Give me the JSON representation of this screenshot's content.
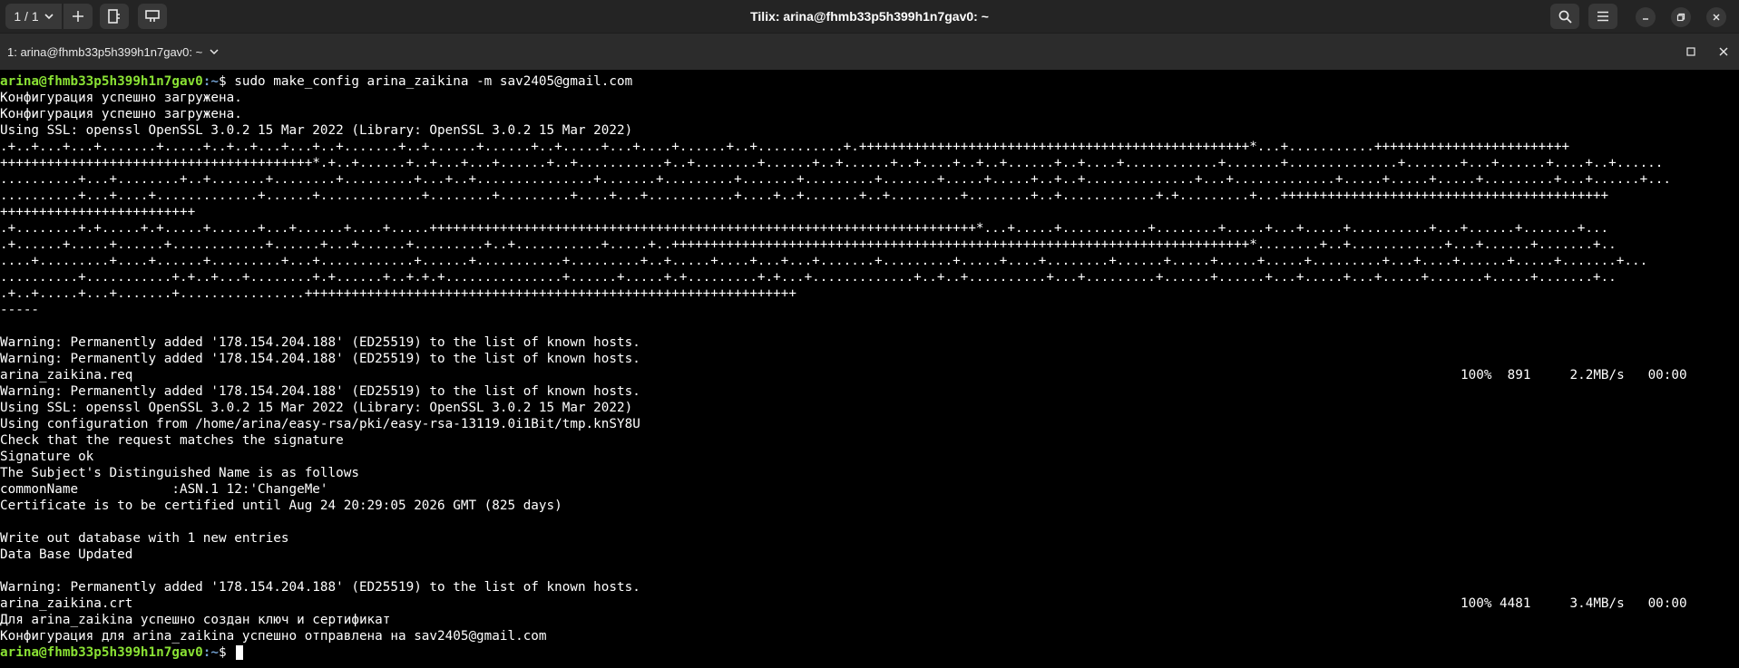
{
  "header": {
    "session_label": "1 / 1",
    "window_title": "Tilix: arina@fhmb33p5h399h1n7gav0: ~"
  },
  "terminal_tab": {
    "title": "1: arina@fhmb33p5h399h1n7gav0: ~"
  },
  "prompt": {
    "user_host": "arina@fhmb33p5h399h1n7gav0",
    "path": ":~",
    "symbol": "$ "
  },
  "command": "sudo make_config arina_zaikina -m sav2405@gmail.com",
  "output_before_keygen": [
    "Конфигурация успешно загружена.",
    "Конфигурация успешно загружена.",
    "Using SSL: openssl OpenSSL 3.0.2 15 Mar 2022 (Library: OpenSSL 3.0.2 15 Mar 2022)"
  ],
  "keygen_lines": [
    ".+..+...+...+.......+.....+..+..+...+...+..+.......+..+......+......+..+.....+...+....+......+..+...........+.++++++++++++++++++++++++++++++++++++++++++++++++++*...+...........+++++++++++++++++++++++++",
    "++++++++++++++++++++++++++++++++++++++++*.+..+......+..+...+...+......+..+...........+..+........+......+..+......+..+....+..+..+......+..+....+............+.......+..............+.......+...+......+....+..+......",
    "..........+...+........+..+.......+........+.........+...+..+...............+.......+.........+.......+.........+.......+.....+.....+..+..+..............+...+.............+.....+.....+.....+.........+...+......+...",
    "..........+...+....+.............+......+.............+........+.........+....+...+...........+....+..+.......+..+.........+........+..+............+.+.........+...++++++++++++++++++++++++++++++++++++++++++",
    "+++++++++++++++++++++++++",
    ".+........+.+.....+.+.....+......+...+......+....+.....++++++++++++++++++++++++++++++++++++++++++++++++++++++++++++++++++++++*...+.....+...........+........+.....+...+.....+..........+...+......+.......+...",
    ".+......+.....+......+............+......+...+......+.........+..+...........+.....+..++++++++++++++++++++++++++++++++++++++++++++++++++++++++++++++++++++++++++*........+..+............+...+......+.......+..",
    "....+.........+....+......+.........+...+............+......+...........+.........+..+.....+....+...+...+.......+.........+.....+....+........+......+.....+.....+.....+.........+...+....+......+.....+.......+...",
    "..........+...........+.+..+...+........+.+......+..+.+.+...............+......+.....+.+.........+.+...+.............+..+..+..........+...+.........+......+......+...+.....+...+.....+.......+.....+.......+..",
    ".+..+.....+...+.......+................+++++++++++++++++++++++++++++++++++++++++++++++++++++++++++++++",
    "-----"
  ],
  "output_after_keygen": [
    "Warning: Permanently added '178.154.204.188' (ED25519) to the list of known hosts.",
    "Warning: Permanently added '178.154.204.188' (ED25519) to the list of known hosts."
  ],
  "transfer_req": {
    "file": "arina_zaikina.req",
    "stats": "100%  891     2.2MB/s   00:00"
  },
  "output_sign": [
    "Warning: Permanently added '178.154.204.188' (ED25519) to the list of known hosts.",
    "Using SSL: openssl OpenSSL 3.0.2 15 Mar 2022 (Library: OpenSSL 3.0.2 15 Mar 2022)",
    "Using configuration from /home/arina/easy-rsa/pki/easy-rsa-13119.0i1Bit/tmp.knSY8U",
    "Check that the request matches the signature",
    "Signature ok",
    "The Subject's Distinguished Name is as follows",
    "commonName            :ASN.1 12:'ChangeMe'",
    "Certificate is to be certified until Aug 24 20:29:05 2026 GMT (825 days)",
    "",
    "Write out database with 1 new entries",
    "Data Base Updated",
    "",
    "Warning: Permanently added '178.154.204.188' (ED25519) to the list of known hosts."
  ],
  "transfer_crt": {
    "file": "arina_zaikina.crt",
    "stats": "100% 4481     3.4MB/s   00:00"
  },
  "output_final": [
    "Для arina_zaikina успешно создан ключ и сертификат",
    "Конфигурация для arina_zaikina успешно отправлена на sav2405@gmail.com"
  ],
  "colors": {
    "prompt_user": "#8ae234",
    "prompt_path": "#729fcf",
    "terminal_bg": "#000000",
    "header_bg": "#242424"
  },
  "icons": {
    "session_chevron": "chevron-down-icon",
    "add": "plus-icon",
    "split_right": "split-right-icon",
    "split_down": "split-down-icon",
    "search": "search-icon",
    "menu": "hamburger-menu-icon",
    "minimize": "minimize-icon",
    "maximize": "maximize-icon",
    "close": "close-icon"
  }
}
